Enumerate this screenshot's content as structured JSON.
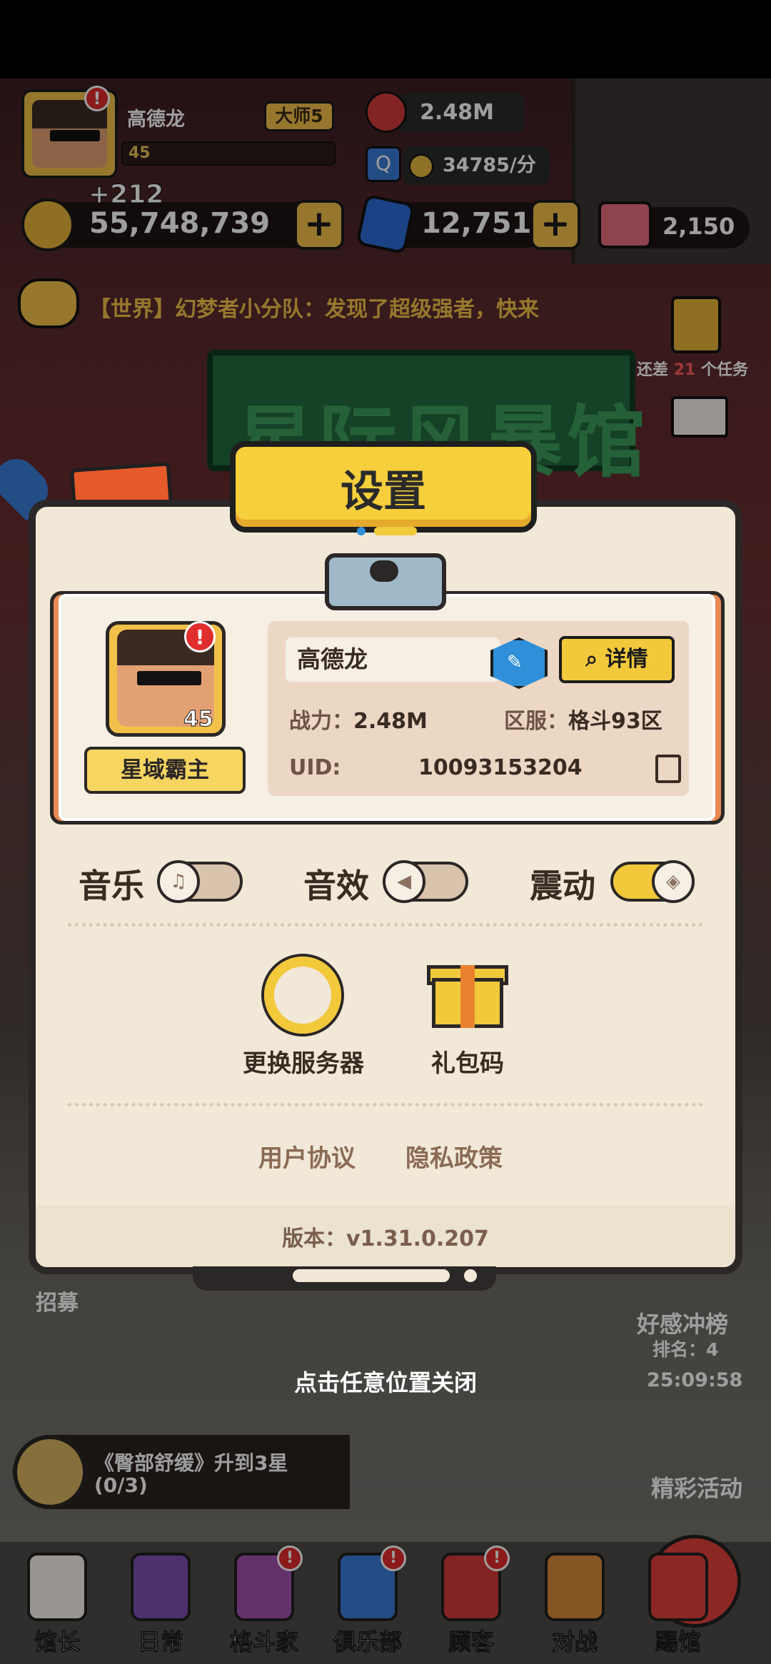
{
  "hud": {
    "player_name": "高德龙",
    "rank_badge": "大师5",
    "level": "45",
    "power": "2.48M",
    "income": "34785/分",
    "gold_gain": "+212",
    "gold": "55,748,739",
    "gems": "12,751",
    "crowns": "2,150",
    "plus_symbol": "+",
    "alert_symbol": "!",
    "search_symbol": "Q"
  },
  "chat": {
    "message": "【世界】幻梦者小分队：发现了超级强者，快来"
  },
  "tasks": {
    "prefix": "还差",
    "count": "21",
    "suffix": "个任务"
  },
  "background": {
    "sign_text": "星际风暴馆"
  },
  "settings": {
    "title": "设置",
    "profile": {
      "name": "高德龙",
      "detail_button": "详情",
      "power_label": "战力：",
      "power_value": "2.48M",
      "server_label": "区服：",
      "server_value": "格斗93区",
      "uid_label": "UID:",
      "uid_value": "10093153204",
      "level": "45",
      "title_badge": "星域霸主"
    },
    "toggles": {
      "music_label": "音乐",
      "music_on": false,
      "sfx_label": "音效",
      "sfx_on": false,
      "vibration_label": "震动",
      "vibration_on": true
    },
    "actions": {
      "change_server": "更换服务器",
      "gift_code": "礼包码"
    },
    "links": {
      "user_agreement": "用户协议",
      "privacy_policy": "隐私政策"
    },
    "version": "版本：v1.31.0.207"
  },
  "overlay": {
    "close_hint": "点击任意位置关闭"
  },
  "side": {
    "recruit": "招募",
    "event_title": "好感冲榜",
    "event_rank": "排名：4",
    "event_timer": "25:09:58",
    "activities": "精彩活动"
  },
  "quest": {
    "text": "《臀部舒缓》升到3星",
    "progress": "(0/3)"
  },
  "nav": {
    "items": [
      {
        "label": "馆长",
        "alert": false
      },
      {
        "label": "日常",
        "alert": false
      },
      {
        "label": "格斗家",
        "alert": true
      },
      {
        "label": "俱乐部",
        "alert": true
      },
      {
        "label": "顾客",
        "alert": true
      },
      {
        "label": "对战",
        "alert": false
      },
      {
        "label": "踢馆",
        "alert": false
      }
    ]
  },
  "colors": {
    "accent_yellow": "#f2c93b",
    "dialog_bg": "#f1e8d7",
    "dark_outline": "#2b2726",
    "alert_red": "#e02d2d"
  }
}
